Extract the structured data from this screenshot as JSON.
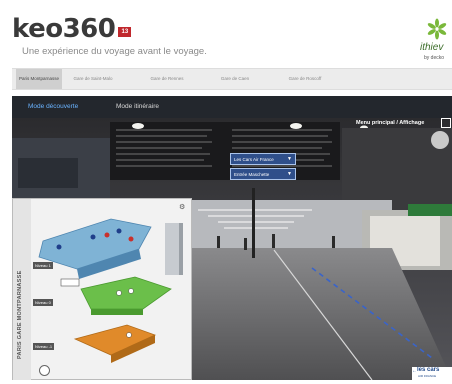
{
  "header": {
    "logo": "keo360",
    "logo_badge": "13",
    "tagline": "Une expérience du voyage avant le voyage.",
    "brand_name": "ithiev",
    "brand_sub": "by decko"
  },
  "tabs": [
    {
      "label": "Paris Montparnasse",
      "active": true
    },
    {
      "label": "Gare de Saint-Malo",
      "active": false
    },
    {
      "label": "Gare de Rennes",
      "active": false
    },
    {
      "label": "Gare de Caen",
      "active": false
    },
    {
      "label": "Gare de Roscoff",
      "active": false
    }
  ],
  "modes": [
    {
      "label": "Mode découverte",
      "active": true
    },
    {
      "label": "Mode itinéraire",
      "active": false
    }
  ],
  "viewer": {
    "menu_label": "Menu principal / Affichage",
    "nav_buttons": [
      "Les Cars Air France",
      "Entrée Maschette"
    ],
    "map_title": "PARIS GARE MONTPARNASSE",
    "levels": [
      "Niveau 1",
      "Niveau 0",
      "Niveau -1"
    ],
    "ad_title": "les cars",
    "ad_sub": "AIR FRANCE"
  },
  "colors": {
    "mode_bar": "#23272d",
    "active_mode": "#6ab3ff",
    "level_blue": "#7fb3d5",
    "level_green": "#6bbf4a",
    "level_orange": "#e08a2a",
    "nav_button": "#2f4f8a"
  },
  "icons": [
    "ithiev-brand-icon",
    "settings-icon",
    "compass-icon",
    "arrow-down-icon",
    "fullscreen-icon",
    "back-arrow-icon"
  ]
}
